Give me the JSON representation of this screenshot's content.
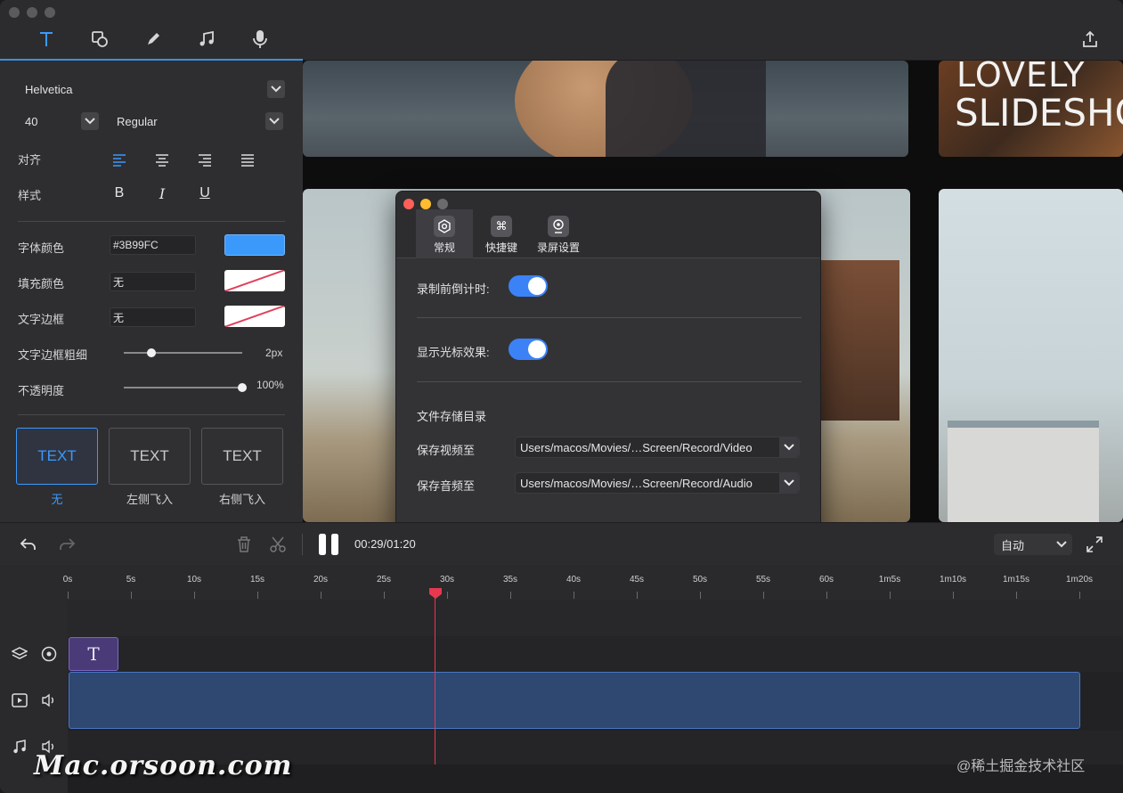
{
  "toolbar": {
    "tools": [
      "text-tool",
      "shape-tool",
      "pen-tool",
      "music-tool",
      "microphone-tool"
    ],
    "active_tool": "text-tool",
    "export": "export-icon"
  },
  "text_panel": {
    "font_family": "Helvetica",
    "font_size": "40",
    "font_weight": "Regular",
    "align_label": "对齐",
    "style_label": "样式",
    "bold": "B",
    "italic": "I",
    "underline": "U",
    "font_color_label": "字体颜色",
    "font_color_value": "#3B99FC",
    "font_color_swatch": "#3b99fc",
    "fill_color_label": "填充颜色",
    "fill_color_value": "无",
    "border_label": "文字边框",
    "border_value": "无",
    "border_width_label": "文字边框粗细",
    "border_width_value": "2px",
    "opacity_label": "不透明度",
    "opacity_value": "100%",
    "border_width_level": 0.23,
    "opacity_level": 1.0,
    "animations": [
      {
        "preview": "TEXT",
        "label": "无",
        "active": true
      },
      {
        "preview": "TEXT",
        "label": "左侧飞入",
        "active": false
      },
      {
        "preview": "TEXT",
        "label": "右侧飞入",
        "active": false
      }
    ]
  },
  "preview": {
    "overlay_title_line1": "LOVELY",
    "overlay_title_line2": "SLIDESHOW"
  },
  "settings_dialog": {
    "tabs": [
      {
        "label": "常规",
        "icon": "gear-icon",
        "active": true
      },
      {
        "label": "快捷键",
        "icon": "command-key-icon",
        "active": false
      },
      {
        "label": "录屏设置",
        "icon": "webcam-icon",
        "active": false
      }
    ],
    "countdown_label": "录制前倒计时:",
    "countdown_on": true,
    "cursor_effect_label": "显示光标效果:",
    "cursor_effect_on": true,
    "storage_section": "文件存储目录",
    "video_path_label": "保存视频至",
    "video_path": "Users/macos/Movies/…Screen/Record/Video",
    "audio_path_label": "保存音频至",
    "audio_path": "Users/macos/Movies/…Screen/Record/Audio"
  },
  "transport": {
    "time": "00:29/01:20",
    "zoom": "自动"
  },
  "timeline": {
    "ticks": [
      "0s",
      "5s",
      "10s",
      "15s",
      "20s",
      "25s",
      "30s",
      "35s",
      "40s",
      "45s",
      "50s",
      "55s",
      "60s",
      "1m5s",
      "1m10s",
      "1m15s",
      "1m20s"
    ],
    "text_clip_glyph": "T",
    "playhead_seconds": 29
  },
  "watermarks": {
    "left": "Mac.orsoon.com",
    "right": "@稀土掘金技术社区"
  }
}
